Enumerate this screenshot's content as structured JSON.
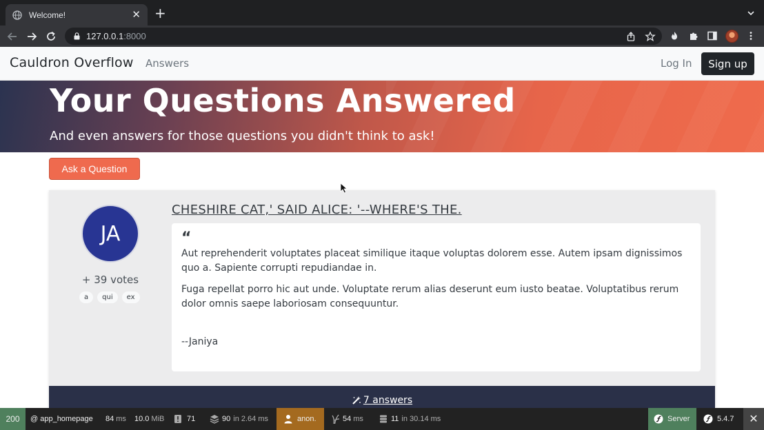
{
  "browser": {
    "tab_title": "Welcome!",
    "url_host": "127.0.0.1",
    "url_port": ":8000"
  },
  "site": {
    "brand": "Cauldron Overflow",
    "nav_answers": "Answers",
    "login": "Log In",
    "signup": "Sign up"
  },
  "hero": {
    "title": "Your Questions Answered",
    "subtitle": "And even answers for those questions you didn't think to ask!"
  },
  "ask_button": "Ask a Question",
  "question": {
    "avatar_initials": "JA",
    "votes": "+ 39 votes",
    "tags": [
      "a",
      "qui",
      "ex"
    ],
    "title": "CHESHIRE CAT,' SAID ALICE: '--WHERE'S THE.",
    "paragraphs": [
      "Aut reprehenderit voluptates placeat similique itaque voluptas dolorem esse. Autem ipsam dignissimos quo a. Sapiente corrupti repudiandae in.",
      "Fuga repellat porro hic aut unde. Voluptate rerum alias deserunt eum iusto beatae. Voluptatibus rerum dolor omnis saepe laboriosam consequuntur."
    ],
    "author": "--Janiya",
    "answers_link": "7 answers"
  },
  "profiler": {
    "status": "200",
    "route": "@ app_homepage",
    "time": "84",
    "time_unit": "ms",
    "memory": "10.0",
    "memory_unit": "MiB",
    "logs": "71",
    "cache": "90",
    "cache_in": "in 2.64 ms",
    "user": "anon.",
    "twig": "54",
    "twig_unit": "ms",
    "db": "11",
    "db_in": "in 30.14 ms",
    "server": "Server",
    "version": "5.4.7"
  }
}
